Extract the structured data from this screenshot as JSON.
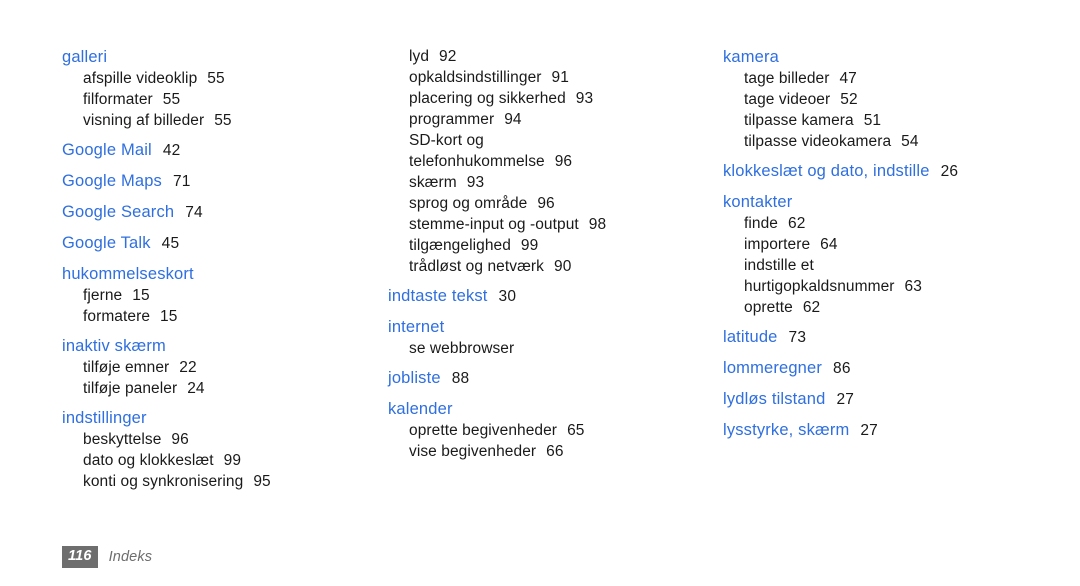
{
  "document": {
    "type": "index-page",
    "language": "da",
    "background_color": "#ffffff",
    "heading_color": "#2f6fdf",
    "body_color": "#1a1a1a",
    "footer_color": "#6e6e6e"
  },
  "columns": [
    {
      "id": "column-1",
      "entries": [
        {
          "head": "galleri",
          "page": "",
          "subitems": [
            {
              "label": "afspille videoklip",
              "page": "55"
            },
            {
              "label": "filformater",
              "page": "55"
            },
            {
              "label": "visning af billeder",
              "page": "55"
            }
          ]
        },
        {
          "head": "Google Mail",
          "page": "42",
          "subitems": []
        },
        {
          "head": "Google Maps",
          "page": "71",
          "subitems": []
        },
        {
          "head": "Google Search",
          "page": "74",
          "subitems": []
        },
        {
          "head": "Google Talk",
          "page": "45",
          "subitems": []
        },
        {
          "head": "hukommelseskort",
          "page": "",
          "subitems": [
            {
              "label": "fjerne",
              "page": "15"
            },
            {
              "label": "formatere",
              "page": "15"
            }
          ]
        },
        {
          "head": "inaktiv skærm",
          "page": "",
          "subitems": [
            {
              "label": "tilføje emner",
              "page": "22"
            },
            {
              "label": "tilføje paneler",
              "page": "24"
            }
          ]
        },
        {
          "head": "indstillinger",
          "page": "",
          "subitems": [
            {
              "label": "beskyttelse",
              "page": "96"
            },
            {
              "label": "dato og klokkeslæt",
              "page": "99"
            },
            {
              "label": "konti og synkronisering",
              "page": "95"
            }
          ]
        }
      ]
    },
    {
      "id": "column-2",
      "continued_subitems": [
        {
          "label": "lyd",
          "page": "92"
        },
        {
          "label": "opkaldsindstillinger",
          "page": "91"
        },
        {
          "label": "placering og sikkerhed",
          "page": "93"
        },
        {
          "label": "programmer",
          "page": "94"
        },
        {
          "label": "SD-kort og telefonhukommelse",
          "page": "96"
        },
        {
          "label": "skærm",
          "page": "93"
        },
        {
          "label": "sprog og område",
          "page": "96"
        },
        {
          "label": "stemme-input og -output",
          "page": "98"
        },
        {
          "label": "tilgængelighed",
          "page": "99"
        },
        {
          "label": "trådløst og netværk",
          "page": "90"
        }
      ],
      "entries": [
        {
          "head": "indtaste tekst",
          "page": "30",
          "subitems": []
        },
        {
          "head": "internet",
          "page": "",
          "subitems": [
            {
              "label": "se webbrowser",
              "page": ""
            }
          ]
        },
        {
          "head": "jobliste",
          "page": "88",
          "subitems": []
        },
        {
          "head": "kalender",
          "page": "",
          "subitems": [
            {
              "label": "oprette begivenheder",
              "page": "65"
            },
            {
              "label": "vise begivenheder",
              "page": "66"
            }
          ]
        }
      ]
    },
    {
      "id": "column-3",
      "entries": [
        {
          "head": "kamera",
          "page": "",
          "subitems": [
            {
              "label": "tage billeder",
              "page": "47"
            },
            {
              "label": "tage videoer",
              "page": "52"
            },
            {
              "label": "tilpasse kamera",
              "page": "51"
            },
            {
              "label": "tilpasse videokamera",
              "page": "54"
            }
          ]
        },
        {
          "head": "klokkeslæt og dato, indstille",
          "page": "26",
          "subitems": []
        },
        {
          "head": "kontakter",
          "page": "",
          "subitems": [
            {
              "label": "finde",
              "page": "62"
            },
            {
              "label": "importere",
              "page": "64"
            },
            {
              "label": "indstille et hurtigopkaldsnummer",
              "page": "63"
            },
            {
              "label": "oprette",
              "page": "62"
            }
          ]
        },
        {
          "head": "latitude",
          "page": "73",
          "subitems": []
        },
        {
          "head": "lommeregner",
          "page": "86",
          "subitems": []
        },
        {
          "head": "lydløs tilstand",
          "page": "27",
          "subitems": []
        },
        {
          "head": "lysstyrke, skærm",
          "page": "27",
          "subitems": []
        }
      ]
    }
  ],
  "footer": {
    "page_number": "116",
    "section_label": "Indeks"
  }
}
